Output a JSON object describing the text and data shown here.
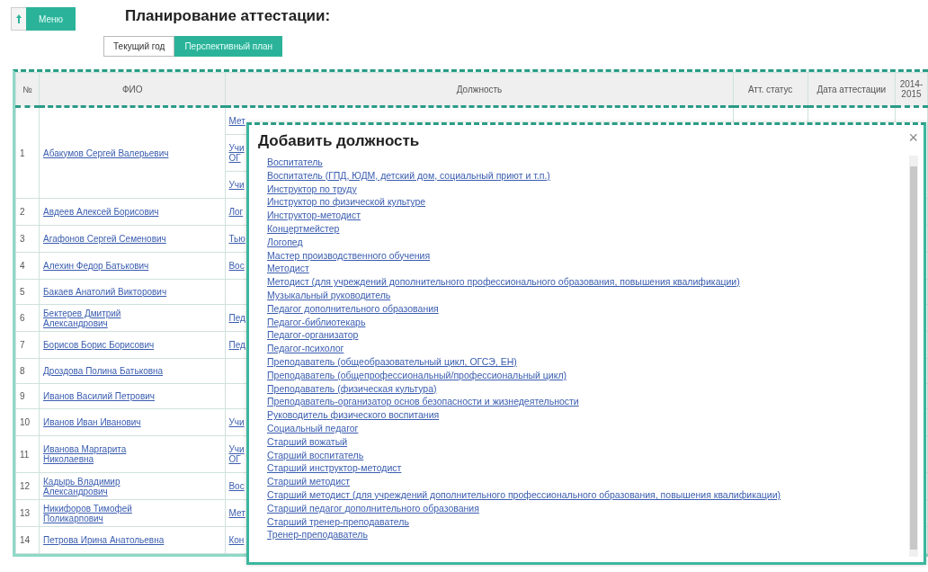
{
  "menu_button": {
    "label": "Меню"
  },
  "title": "Планирование аттестации:",
  "tabs": [
    {
      "label": "Текущий год",
      "selected": false
    },
    {
      "label": "Перспективный план",
      "selected": true
    }
  ],
  "table": {
    "columns": [
      "№",
      "ФИО",
      "Должность",
      "Атт. статус",
      "Дата аттестации",
      "2014-2015"
    ],
    "rows": [
      {
        "number": "1",
        "name": "Абакумов Сергей Валерьевич",
        "positions": [
          "Мет",
          "Учи ОГ",
          "Учи"
        ]
      },
      {
        "number": "2",
        "name": "Авдеев Алексей Борисович",
        "positions": [
          "Лог"
        ]
      },
      {
        "number": "3",
        "name": "Агафонов Сергей Семенович",
        "positions": [
          "Тью"
        ]
      },
      {
        "number": "4",
        "name": "Алехин Федор Батькович",
        "positions": [
          "Вос"
        ]
      },
      {
        "number": "5",
        "name": "Бакаев Анатолий Викторович",
        "positions": []
      },
      {
        "number": "6",
        "name": "Бектерев Дмитрий Александрович",
        "positions": [
          "Пед"
        ]
      },
      {
        "number": "7",
        "name": "Борисов Борис Борисович",
        "positions": [
          "Пед"
        ]
      },
      {
        "number": "8",
        "name": "Дроздова Полина Батьковна",
        "positions": []
      },
      {
        "number": "9",
        "name": "Иванов Василий Петрович",
        "positions": []
      },
      {
        "number": "10",
        "name": "Иванов Иван Иванович",
        "positions": [
          "Учи"
        ]
      },
      {
        "number": "11",
        "name": "Иванова Маргарита Николаевна",
        "positions": [
          "Учи ОГ"
        ]
      },
      {
        "number": "12",
        "name": "Кадырь Владимир Александрович",
        "positions": [
          "Вос"
        ]
      },
      {
        "number": "13",
        "name": "Никифоров Тимофей Поликарпович",
        "positions": [
          "Мет"
        ]
      },
      {
        "number": "14",
        "name": "Петрова Ирина Анатольевна",
        "positions": [
          "Кон"
        ]
      }
    ]
  },
  "dialog": {
    "title": "Добавить должность",
    "close": "×",
    "items": [
      "Воспитатель",
      "Воспитатель (ГПД, ЮДМ, детский дом, социальный приют и т.п.)",
      "Инструктор по труду",
      "Инструктор по физической культуре",
      "Инструктор-методист",
      "Концертмейстер",
      "Логопед",
      "Мастер производственного обучения",
      "Методист",
      "Методист (для учреждений дополнительного профессионального образования, повышения квалификации)",
      "Музыкальный руководитель",
      "Педагог дополнительного образования",
      "Педагог-библиотекарь",
      "Педагог-организатор",
      "Педагог-психолог",
      "Преподаватель (общеобразовательный цикл, ОГСЭ, ЕН)",
      "Преподаватель (общепрофессиональный/профессиональный цикл)",
      "Преподаватель (физическая культура)",
      "Преподаватель-организатор основ безопасности и жизнедеятельности",
      "Руководитель физического воспитания",
      "Социальный педагог",
      "Старший вожатый",
      "Старший воспитатель",
      "Старший инструктор-методист",
      "Старший методист",
      "Старший методист (для учреждений дополнительного профессионального образования, повышения квалификации)",
      "Старший педагог дополнительного образования",
      "Старший тренер-преподаватель",
      "Тренер-преподаватель"
    ]
  }
}
